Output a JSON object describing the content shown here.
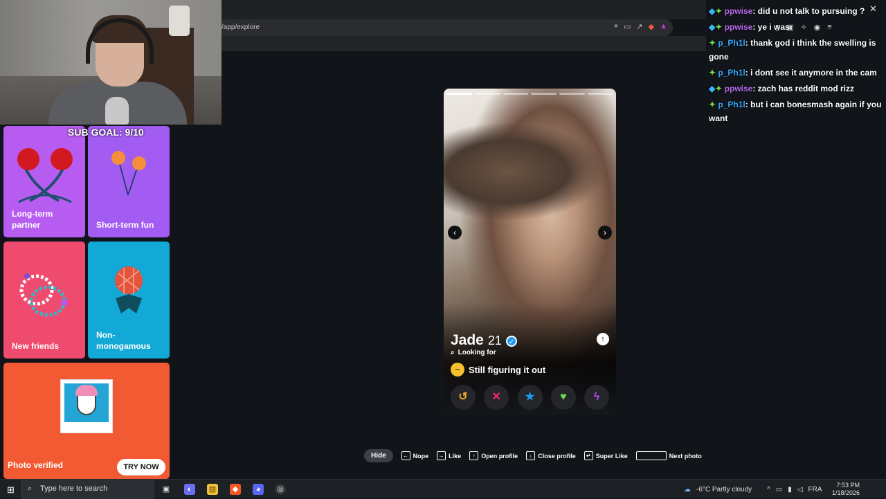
{
  "browser": {
    "url": "/app/explore",
    "close_glyph": "✕"
  },
  "overlay": {
    "sub_goal": "SUB GOAL: 9/10"
  },
  "tiles": [
    {
      "label": "Long-term partner"
    },
    {
      "label": "Short-term fun"
    },
    {
      "label": "New friends"
    },
    {
      "label": "Non-monogamous"
    },
    {
      "label": "Photo verified",
      "button": "TRY NOW"
    }
  ],
  "profile": {
    "name": "Jade",
    "age": "21",
    "looking_for_label": "Looking for",
    "looking_for_value": "Still figuring it out",
    "photo_count": 6,
    "active_photo": 0
  },
  "hints": {
    "hide": "Hide",
    "nope": "Nope",
    "like": "Like",
    "open_profile": "Open profile",
    "close_profile": "Close profile",
    "super_like": "Super Like",
    "next_photo": "Next photo"
  },
  "chat": [
    {
      "user": "ppwise",
      "badge": "sub",
      "text": ": did u not talk to pursuing ?"
    },
    {
      "user": "ppwise",
      "badge": "sub",
      "text": ": ye i was"
    },
    {
      "user": "p_Ph1l",
      "badge": "vip",
      "text": ": thank god i think the swelling is gone"
    },
    {
      "user": "p_Ph1l",
      "badge": "vip",
      "text": ": i dont see it anymore in the cam"
    },
    {
      "user": "ppwise",
      "badge": "sub",
      "text": ": zach has reddit mod rizz"
    },
    {
      "user": "p_Ph1l",
      "badge": "vip",
      "text": ": but i can bonesmash again if you want"
    }
  ],
  "taskbar": {
    "search_placeholder": "Type here to search",
    "weather": "-6°C  Partly cloudy",
    "language": "FRA",
    "time": "7:53 PM",
    "date": "1/18/2026"
  },
  "colors": {
    "tile_long_term": "#b75cf0",
    "tile_short_term": "#a35cf2",
    "tile_friends": "#ef4b6e",
    "tile_non_mono": "#12a9d6",
    "tile_verified": "#f15a33",
    "nope": "#fd267a",
    "superlike": "#1e9bf0",
    "like": "#6fd84a",
    "boost": "#b44cf0",
    "rewind": "#f5a623"
  }
}
